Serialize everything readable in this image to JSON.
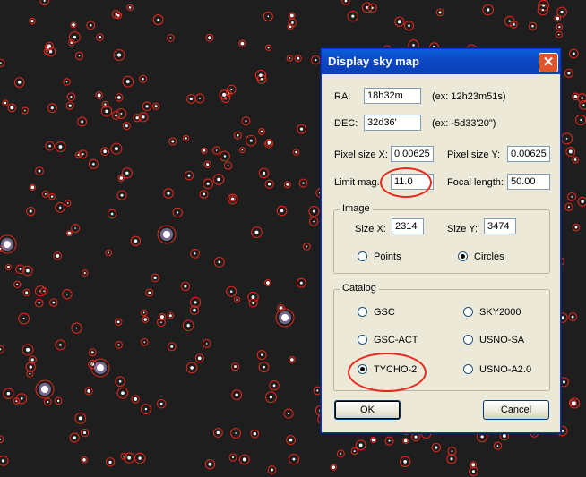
{
  "dialog": {
    "title": "Display sky map",
    "close_glyph": "✕",
    "ra": {
      "label": "RA:",
      "value": "18h32m",
      "example": "(ex: 12h23m51s)"
    },
    "dec": {
      "label": "DEC:",
      "value": "32d36'",
      "example": "(ex: -5d33'20\")"
    },
    "pixel_size_x": {
      "label": "Pixel size X:",
      "value": "0.00625"
    },
    "pixel_size_y": {
      "label": "Pixel size Y:",
      "value": "0.00625"
    },
    "limit_mag": {
      "label": "Limit mag.:",
      "value": "11.0"
    },
    "focal_length": {
      "label": "Focal length:",
      "value": "50.00"
    },
    "image_group": {
      "title": "Image",
      "size_x": {
        "label": "Size X:",
        "value": "2314"
      },
      "size_y": {
        "label": "Size Y:",
        "value": "3474"
      },
      "modes": [
        {
          "label": "Points",
          "selected": false
        },
        {
          "label": "Circles",
          "selected": true
        }
      ]
    },
    "catalog_group": {
      "title": "Catalog",
      "options": [
        {
          "label": "GSC",
          "selected": false
        },
        {
          "label": "SKY2000",
          "selected": false
        },
        {
          "label": "GSC-ACT",
          "selected": false
        },
        {
          "label": "USNO-SA",
          "selected": false
        },
        {
          "label": "TYCHO-2",
          "selected": true
        },
        {
          "label": "USNO-A2.0",
          "selected": false
        }
      ]
    },
    "ok_label": "OK",
    "cancel_label": "Cancel"
  },
  "colors": {
    "sky_background": "#1e1e1e",
    "marker": "#e8281a",
    "titlebar": "#0b4fc8",
    "dialog_face": "#ece9d8"
  }
}
